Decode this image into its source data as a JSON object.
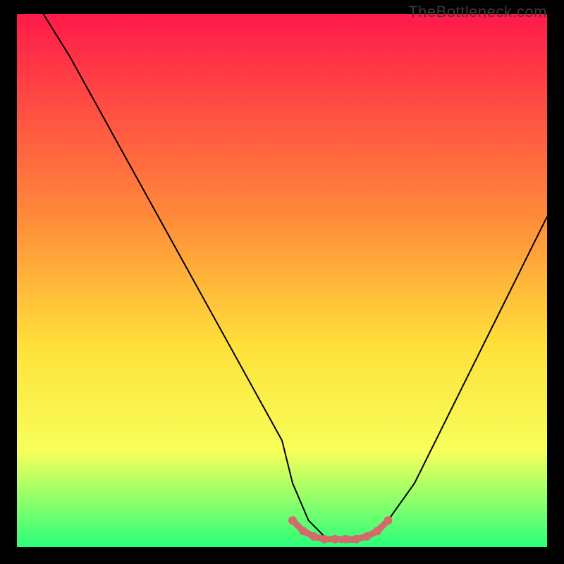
{
  "watermark": "TheBottleneck.com",
  "colors": {
    "frame": "#000000",
    "grad_top": "#ff1a4a",
    "grad_mid1": "#ff8a3a",
    "grad_mid2": "#ffe03a",
    "grad_mid3": "#f7ff5a",
    "grad_bottom": "#2aff7a",
    "curve": "#000000",
    "sweet": "#d66a6a"
  },
  "chart_data": {
    "type": "line",
    "title": "",
    "xlabel": "",
    "ylabel": "",
    "xlim": [
      0,
      100
    ],
    "ylim": [
      0,
      100
    ],
    "series": [
      {
        "name": "bottleneck-curve",
        "x": [
          5,
          10,
          15,
          20,
          25,
          30,
          35,
          40,
          45,
          50,
          52,
          55,
          58,
          61,
          64,
          67,
          70,
          75,
          80,
          85,
          90,
          95,
          100
        ],
        "y": [
          100,
          92,
          83,
          74,
          65,
          56,
          47,
          38,
          29,
          20,
          12,
          5,
          2,
          1,
          1,
          2,
          5,
          12,
          22,
          32,
          42,
          52,
          62
        ]
      },
      {
        "name": "sweet-spot",
        "x": [
          52,
          54,
          56,
          58,
          60,
          62,
          64,
          66,
          68,
          70
        ],
        "y": [
          5,
          3,
          2,
          1.5,
          1.5,
          1.5,
          1.5,
          2,
          3,
          5
        ]
      }
    ]
  }
}
